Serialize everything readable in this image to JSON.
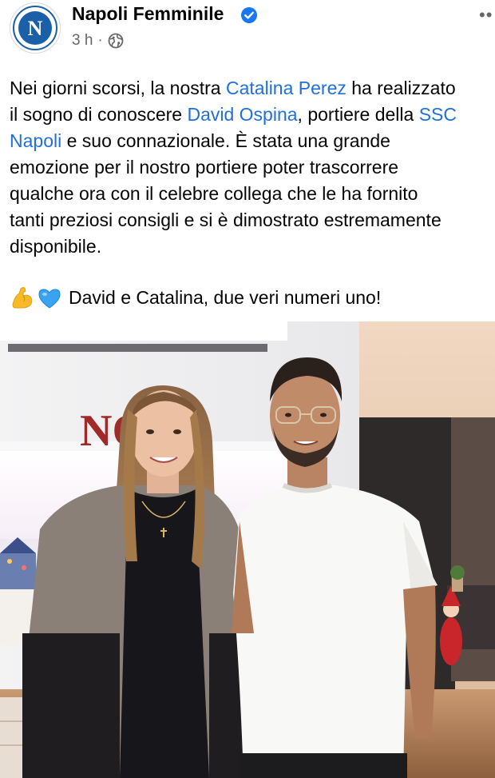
{
  "post": {
    "page_name": "Napoli Femminile",
    "time": "3 h",
    "dot": "·",
    "more_label": "••",
    "avatar_letter": "N",
    "text_lines": [
      [
        "Nei giorni scorsi, la nostra ",
        "Catalina Perez",
        " ha realizzato"
      ],
      [
        "il sogno di conoscere ",
        "David Ospina",
        ", portiere della ",
        "SSC"
      ],
      [
        "Napoli",
        " e suo connazionale. È stata una grande"
      ],
      [
        "emozione per il nostro portiere poter trascorrere"
      ],
      [
        "qualche ora con il celebre collega che le ha fornito"
      ],
      [
        "tanti preziosi consigli e si è dimostrato estremamente"
      ],
      [
        "disponibile."
      ]
    ],
    "sign_off": "David e Catalina, due veri numeri uno!",
    "emojis": [
      "flexed-biceps",
      "blue-heart"
    ],
    "photo_sign_text": "NO",
    "link_color": "#216fdb",
    "verified_color": "#1877f2"
  }
}
